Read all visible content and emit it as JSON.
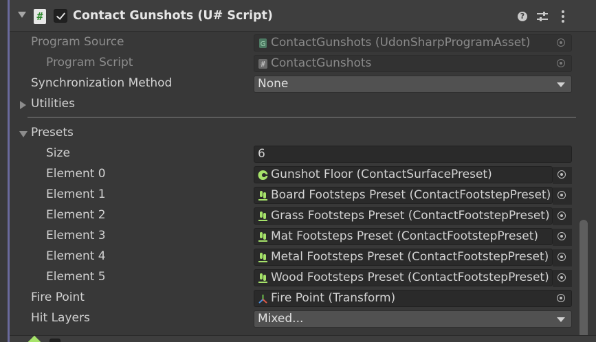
{
  "component": {
    "title": "Contact Gunshots (U# Script)",
    "enabled": true,
    "icons": {
      "fold": "chevron-down-icon",
      "script": "csharp-script-icon",
      "help": "help-icon",
      "presets": "presets-icon",
      "menu": "kebab-menu-icon"
    },
    "script_glyph": "#",
    "help_glyph": "?"
  },
  "fields": {
    "program_source": {
      "label": "Program Source",
      "value": "ContactGunshots (UdonSharpProgramAsset)",
      "icon": "udon-program-asset-icon"
    },
    "program_script": {
      "label": "Program Script",
      "value": "ContactGunshots",
      "icon": "csharp-script-icon"
    },
    "sync_method": {
      "label": "Synchronization Method",
      "value": "None"
    },
    "utilities": {
      "label": "Utilities",
      "expanded": false
    },
    "presets": {
      "label": "Presets",
      "expanded": true,
      "size_label": "Size",
      "size": "6",
      "elements": [
        {
          "label": "Element 0",
          "value": "Gunshot Floor (ContactSurfacePreset)",
          "icon": "contact-surface-preset-icon"
        },
        {
          "label": "Element 1",
          "value": "Board Footsteps Preset (ContactFootstepPreset)",
          "icon": "contact-footstep-preset-icon"
        },
        {
          "label": "Element 2",
          "value": "Grass Footsteps Preset (ContactFootstepPreset)",
          "icon": "contact-footstep-preset-icon"
        },
        {
          "label": "Element 3",
          "value": "Mat Footsteps Preset (ContactFootstepPreset)",
          "icon": "contact-footstep-preset-icon"
        },
        {
          "label": "Element 4",
          "value": "Metal Footsteps Preset (ContactFootstepPreset)",
          "icon": "contact-footstep-preset-icon"
        },
        {
          "label": "Element 5",
          "value": "Wood Footsteps Preset (ContactFootstepPreset)",
          "icon": "contact-footstep-preset-icon"
        }
      ]
    },
    "fire_point": {
      "label": "Fire Point",
      "value": "Fire Point (Transform)",
      "icon": "transform-icon"
    },
    "hit_layers": {
      "label": "Hit Layers",
      "value": "Mixed..."
    }
  },
  "colors": {
    "background": "#383838",
    "header": "#3e3e3e",
    "field": "#2a2a2a",
    "dropdown": "#515151",
    "accent_bar": "#6a6a9c",
    "preset_icon_green": "#a6e36a"
  }
}
